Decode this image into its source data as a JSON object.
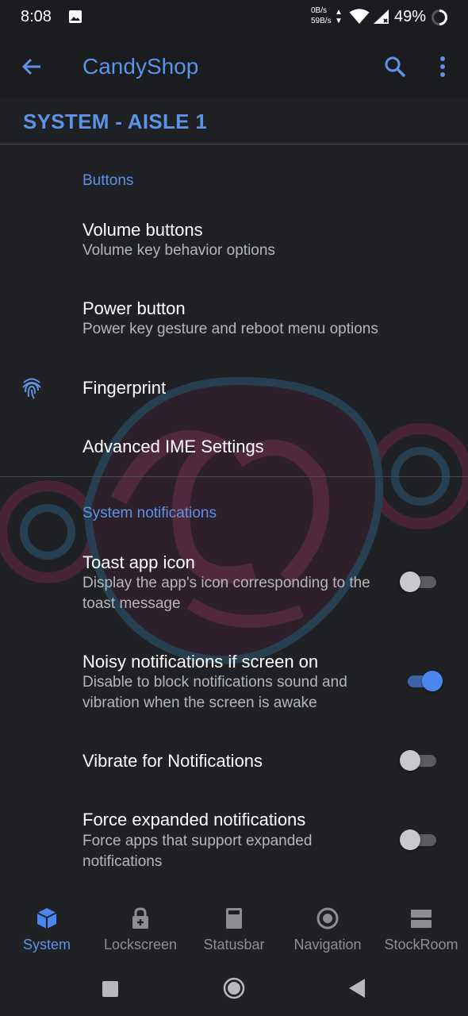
{
  "status_bar": {
    "time": "8:08",
    "net_down": "0B/s",
    "net_up": "59B/s",
    "battery": "49%",
    "icons": [
      "image-icon",
      "wifi-icon",
      "signal-icon",
      "battery-ring-icon"
    ]
  },
  "app_bar": {
    "title": "CandyShop",
    "back_icon": "arrow-back-icon",
    "search_icon": "search-icon",
    "more_icon": "more-vert-icon"
  },
  "section_header": "SYSTEM - AISLE 1",
  "categories": {
    "buttons": "Buttons",
    "notifications": "System notifications"
  },
  "prefs": [
    {
      "title": "Volume buttons",
      "summary": "Volume key behavior options"
    },
    {
      "title": "Power button",
      "summary": "Power key gesture and reboot menu options"
    },
    {
      "title": "Fingerprint",
      "icon": "fingerprint-icon"
    },
    {
      "title": "Advanced IME Settings"
    }
  ],
  "notif_prefs": [
    {
      "title": "Toast app icon",
      "summary": "Display the app's icon corresponding to the toast message",
      "enabled": false
    },
    {
      "title": "Noisy notifications if screen on",
      "summary": "Disable to block notifications sound and vibration when the screen is awake",
      "enabled": true
    },
    {
      "title": "Vibrate for Notifications",
      "enabled": false
    },
    {
      "title": "Force expanded notifications",
      "summary": "Force apps that support expanded notifications",
      "enabled": false
    }
  ],
  "bottom_nav": [
    {
      "label": "System",
      "icon": "cube-icon",
      "active": true
    },
    {
      "label": "Lockscreen",
      "icon": "lock-icon",
      "active": false
    },
    {
      "label": "Statusbar",
      "icon": "statusbar-icon",
      "active": false
    },
    {
      "label": "Navigation",
      "icon": "radio-circle-icon",
      "active": false
    },
    {
      "label": "StockRoom",
      "icon": "stockroom-icon",
      "active": false
    }
  ],
  "colors": {
    "accent": "#5c93e6",
    "background": "#1f2125",
    "switch_on": "#4b86f0"
  }
}
